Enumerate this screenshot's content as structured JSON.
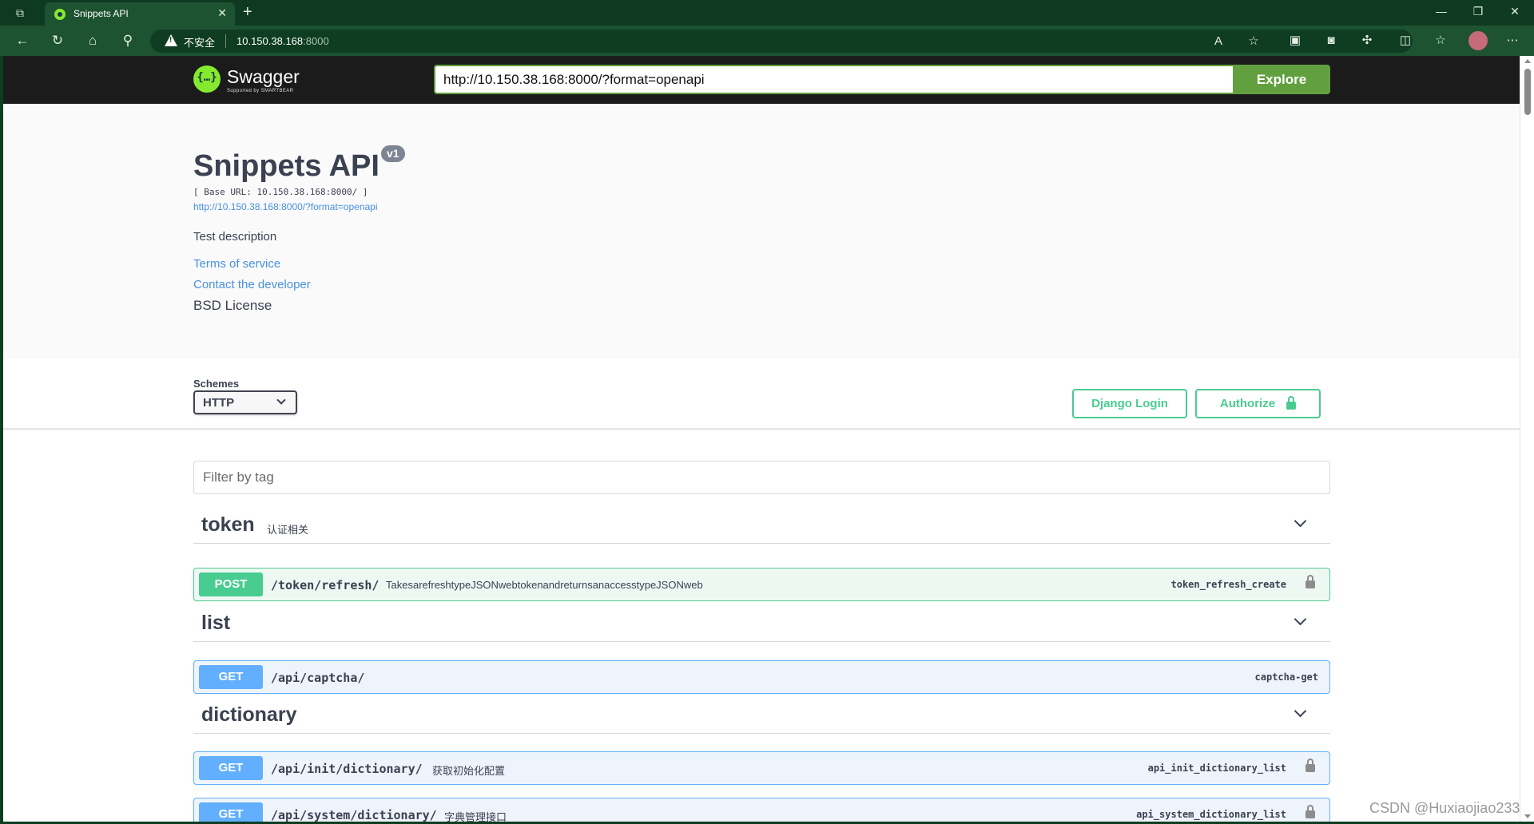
{
  "browser": {
    "tab_title": "Snippets API",
    "insecure_label": "不安全",
    "host": "10.150.38.168",
    "port": ":8000"
  },
  "topbar": {
    "brand": "Swagger",
    "brand_sub": "Supported by SMARTBEAR",
    "spec_url": "http://10.150.38.168:8000/?format=openapi",
    "explore_label": "Explore"
  },
  "info": {
    "title": "Snippets API",
    "version": "v1",
    "base_url": "[ Base URL: 10.150.38.168:8000/ ]",
    "spec_link": "http://10.150.38.168:8000/?format=openapi",
    "description": "Test description",
    "terms": "Terms of service",
    "contact": "Contact the developer",
    "license": "BSD License"
  },
  "schemes": {
    "label": "Schemes",
    "selected": "HTTP",
    "django_login": "Django Login",
    "authorize": "Authorize"
  },
  "filter": {
    "placeholder": "Filter by tag"
  },
  "tags": [
    {
      "name": "token",
      "description": "认证相关",
      "operations": [
        {
          "method": "POST",
          "path": "/token/refresh/",
          "summary": "TakesarefreshtypeJSONwebtokenandreturnsanaccesstypeJSONweb",
          "operation_id": "token_refresh_create"
        }
      ]
    },
    {
      "name": "list",
      "description": "",
      "operations": [
        {
          "method": "GET",
          "path": "/api/captcha/",
          "summary": "",
          "operation_id": "captcha-get"
        }
      ]
    },
    {
      "name": "dictionary",
      "description": "",
      "operations": [
        {
          "method": "GET",
          "path": "/api/init/dictionary/",
          "summary": "获取初始化配置",
          "operation_id": "api_init_dictionary_list"
        },
        {
          "method": "GET",
          "path": "/api/system/dictionary/",
          "summary": "字典管理接口",
          "operation_id": "api_system_dictionary_list"
        }
      ]
    }
  ],
  "watermark": "CSDN @Huxiaojiao233"
}
